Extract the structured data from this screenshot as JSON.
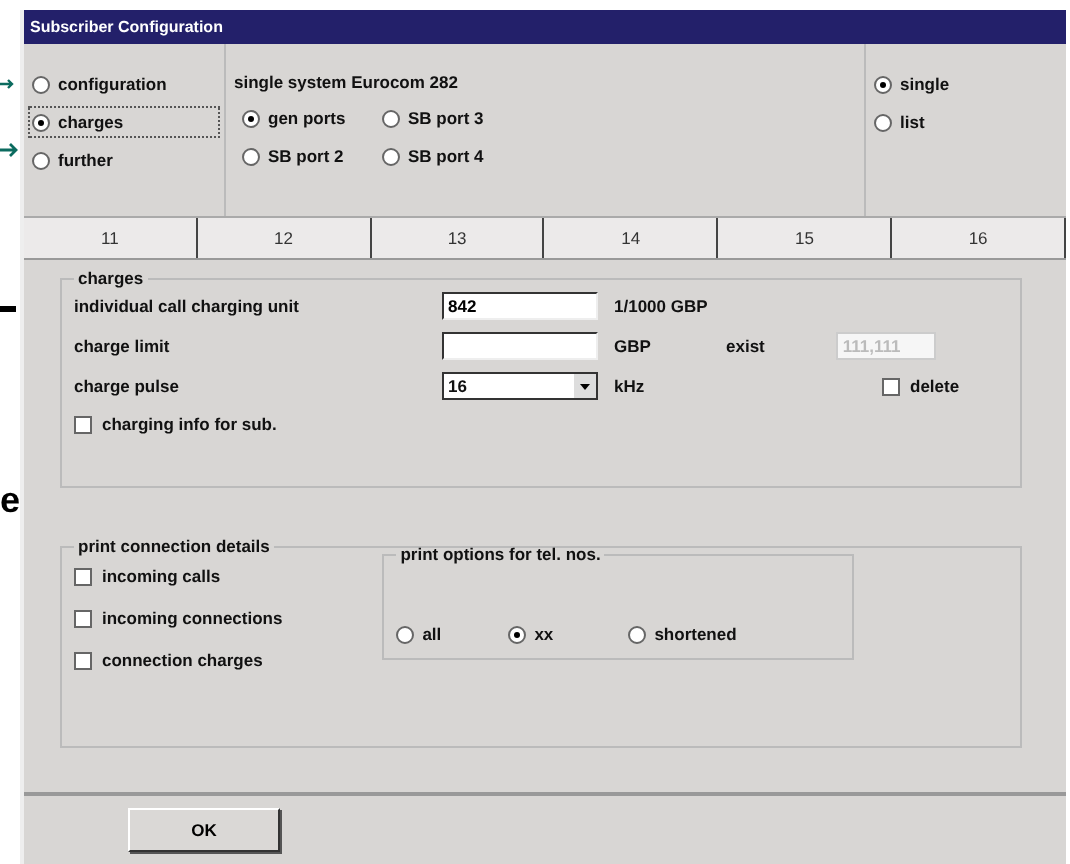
{
  "window": {
    "title": "Subscriber Configuration"
  },
  "margin_text": "e",
  "mode_options": [
    {
      "label": "configuration",
      "selected": false
    },
    {
      "label": "charges",
      "selected": true
    },
    {
      "label": "further",
      "selected": false
    }
  ],
  "system": {
    "title": "single system Eurocom 282",
    "ports": [
      {
        "label": "gen ports",
        "selected": true
      },
      {
        "label": "SB port 3",
        "selected": false
      },
      {
        "label": "SB port 2",
        "selected": false
      },
      {
        "label": "SB port 4",
        "selected": false
      }
    ]
  },
  "view_options": [
    {
      "label": "single",
      "selected": true
    },
    {
      "label": "list",
      "selected": false
    }
  ],
  "tabs": [
    {
      "label": "11"
    },
    {
      "label": "12"
    },
    {
      "label": "13"
    },
    {
      "label": "14"
    },
    {
      "label": "15"
    },
    {
      "label": "16"
    }
  ],
  "charges": {
    "title": "charges",
    "unit": {
      "label": "individual call charging unit",
      "value": "842",
      "unit": "1/1000 GBP"
    },
    "limit": {
      "label": "charge limit",
      "unit": "GBP",
      "rest_label": "exist",
      "rest_value": "111,111",
      "rest_disabled": true
    },
    "pulse": {
      "label": "charge pulse",
      "value": "16",
      "unit": "kHz"
    },
    "delete": {
      "label": "delete",
      "checked": false
    },
    "charging_info": {
      "label": "charging info for sub.",
      "checked": false
    }
  },
  "print": {
    "title": "print connection details",
    "checkboxes": [
      {
        "label": "incoming calls",
        "checked": false
      },
      {
        "label": "incoming connections",
        "checked": false
      },
      {
        "label": "connection charges",
        "checked": false
      }
    ],
    "options_title": "print options for tel. nos.",
    "options": [
      {
        "label": "all",
        "selected": false
      },
      {
        "label": "xx",
        "selected": true
      },
      {
        "label": "shortened",
        "selected": false
      }
    ]
  },
  "buttons": [
    "OK"
  ]
}
